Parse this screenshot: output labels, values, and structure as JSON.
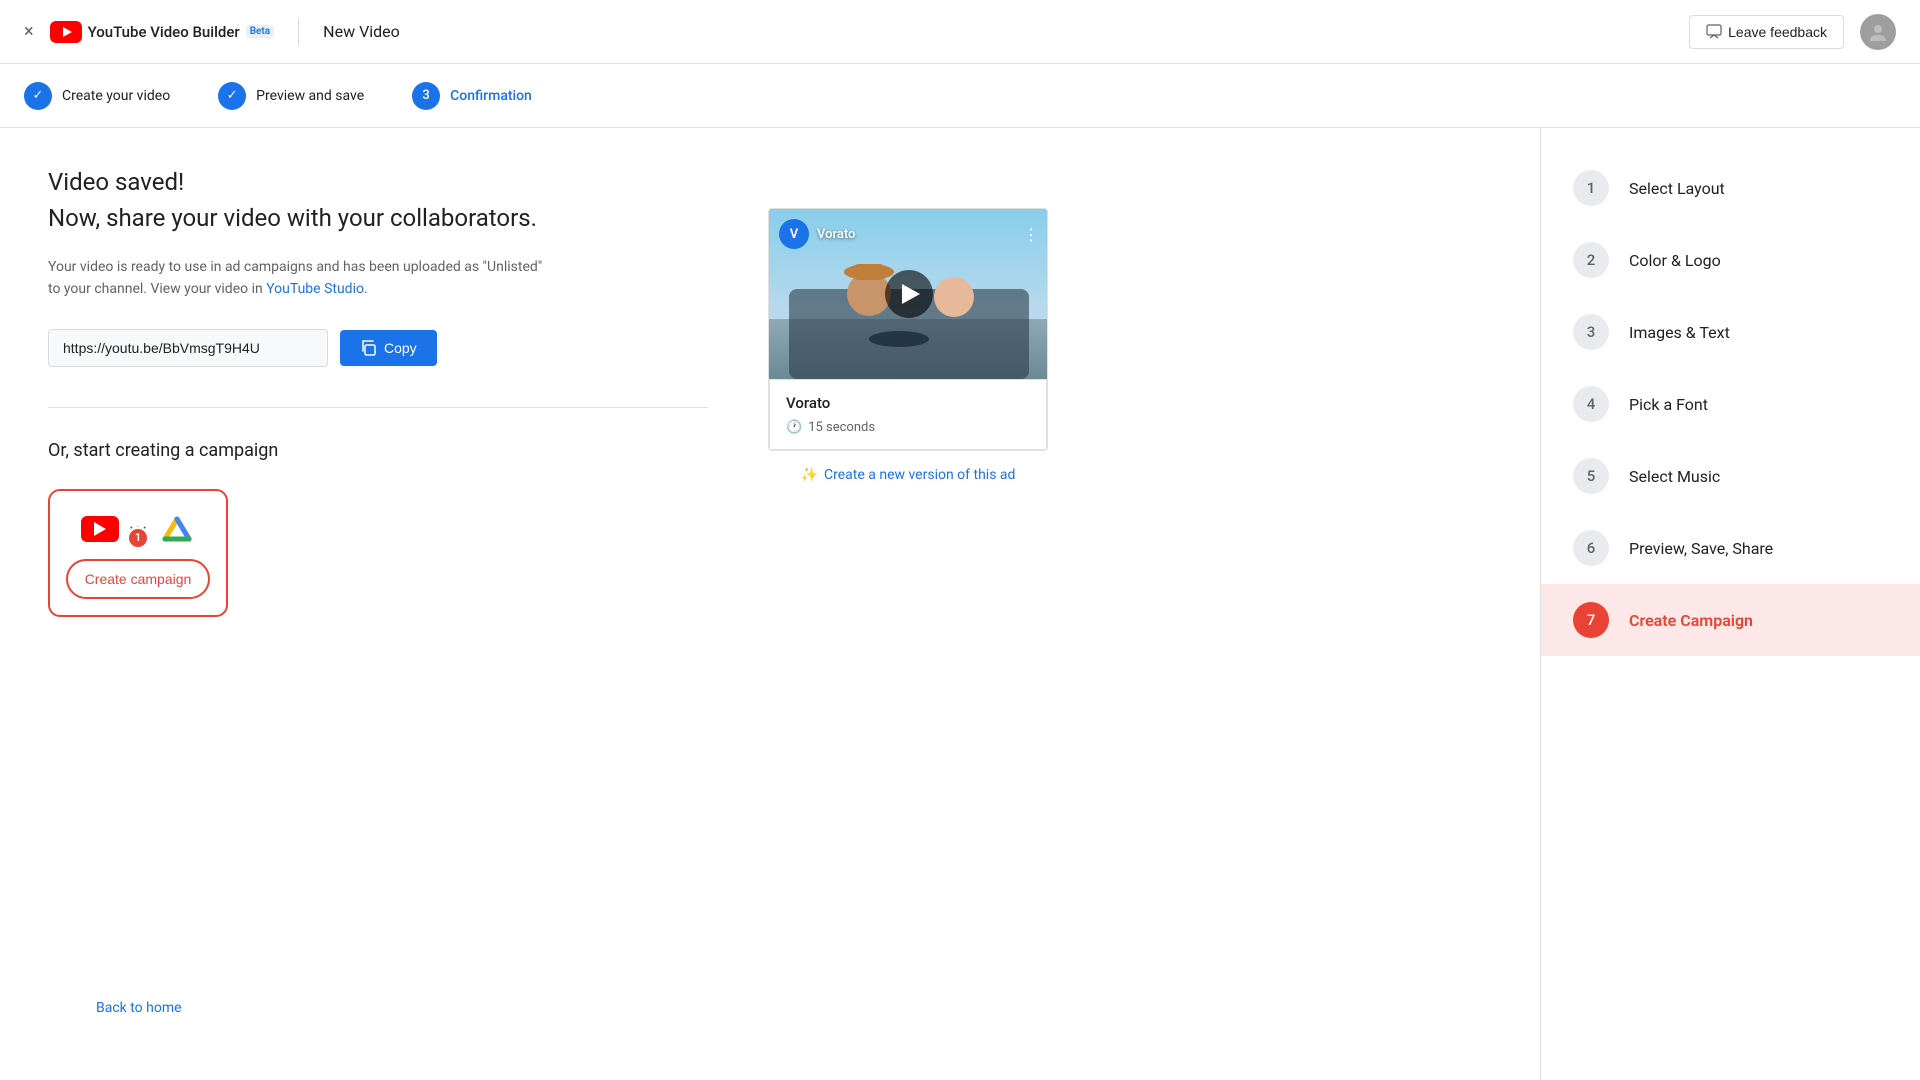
{
  "header": {
    "title": "New Video",
    "logo_text": "YouTube Video Builder",
    "beta_label": "Beta",
    "feedback_label": "Leave feedback",
    "close_label": "×"
  },
  "progress": {
    "steps": [
      {
        "id": 1,
        "label": "Create your video",
        "state": "completed",
        "icon": "✓"
      },
      {
        "id": 2,
        "label": "Preview and save",
        "state": "completed",
        "icon": "✓"
      },
      {
        "id": 3,
        "label": "Confirmation",
        "state": "active"
      }
    ]
  },
  "main": {
    "video_saved_title": "Video saved!",
    "video_saved_subtitle": "Now, share your video with your collaborators.",
    "video_saved_desc_part1": "Your video is ready to use in ad campaigns and has been uploaded as \"Unlisted\"",
    "video_saved_desc_part2": "to your channel. View your video in",
    "video_saved_desc_link": "YouTube Studio.",
    "url_value": "https://youtu.be/BbVmsgT9H4U",
    "copy_label": "Copy",
    "divider": true,
    "campaign_title": "Or, start creating a campaign",
    "create_campaign_btn": "Create campaign",
    "notification_count": "1"
  },
  "video_preview": {
    "channel_name": "Vorato",
    "channel_initial": "V",
    "video_title": "Vorato",
    "duration": "15 seconds",
    "create_new_label": "Create a new version of this ad"
  },
  "sidebar": {
    "steps": [
      {
        "id": 1,
        "label": "Select Layout",
        "state": "inactive"
      },
      {
        "id": 2,
        "label": "Color & Logo",
        "state": "inactive"
      },
      {
        "id": 3,
        "label": "Images & Text",
        "state": "inactive"
      },
      {
        "id": 4,
        "label": "Pick a Font",
        "state": "inactive"
      },
      {
        "id": 5,
        "label": "Select Music",
        "state": "inactive"
      },
      {
        "id": 6,
        "label": "Preview, Save, Share",
        "state": "inactive"
      },
      {
        "id": 7,
        "label": "Create Campaign",
        "state": "active"
      }
    ]
  },
  "footer": {
    "back_label": "Back to home"
  }
}
